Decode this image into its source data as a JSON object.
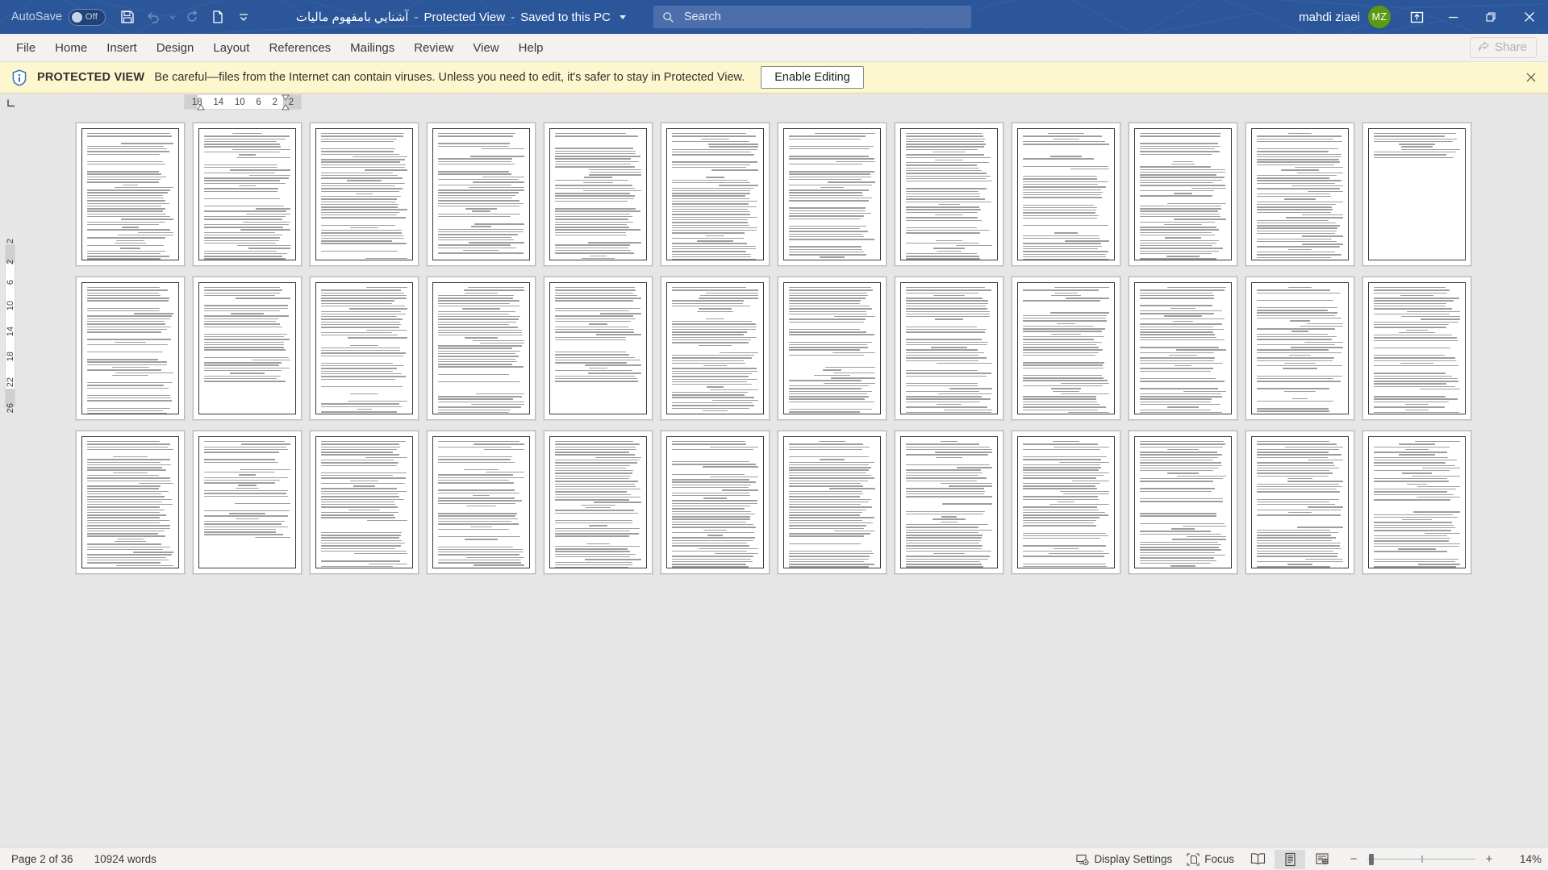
{
  "titlebar": {
    "autosave_label": "AutoSave",
    "autosave_state": "Off",
    "qat": [
      {
        "name": "save-icon",
        "label": "Save",
        "disabled": false
      },
      {
        "name": "undo-icon",
        "label": "Undo",
        "disabled": true
      },
      {
        "name": "undo-dropdown-icon",
        "label": "Undo options",
        "disabled": true
      },
      {
        "name": "redo-icon",
        "label": "Redo",
        "disabled": true
      },
      {
        "name": "print-preview-icon",
        "label": "Print Preview and Print",
        "disabled": false
      },
      {
        "name": "customize-qat-icon",
        "label": "Customize Quick Access Toolbar",
        "disabled": false
      }
    ],
    "document_name": "آشنايي بامفهوم ماليات",
    "protected_view_tag": "Protected View",
    "save_state": "Saved to this PC",
    "search_placeholder": "Search",
    "search_value": "",
    "account_name": "mahdi ziaei",
    "account_initials": "MZ",
    "ribbon_display_label": "Ribbon Display Options",
    "minimize_label": "Minimize",
    "restore_label": "Restore Down",
    "close_label": "Close",
    "bg_color": "#2b579a",
    "avatar_color": "#5a9b13"
  },
  "ribbon": {
    "tabs": [
      {
        "label": "File",
        "active": false
      },
      {
        "label": "Home",
        "active": false
      },
      {
        "label": "Insert",
        "active": false
      },
      {
        "label": "Design",
        "active": false
      },
      {
        "label": "Layout",
        "active": false
      },
      {
        "label": "References",
        "active": false
      },
      {
        "label": "Mailings",
        "active": false
      },
      {
        "label": "Review",
        "active": false
      },
      {
        "label": "View",
        "active": false
      },
      {
        "label": "Help",
        "active": false
      }
    ],
    "share_label": "Share"
  },
  "protected_view": {
    "badge": "PROTECTED VIEW",
    "message": "Be careful—files from the Internet can contain viruses. Unless you need to edit, it's safer to stay in Protected View.",
    "enable_label": "Enable Editing",
    "close_label": "Close Message Bar",
    "bg_color": "#fdf7cf"
  },
  "rulers": {
    "horizontal_ticks": [
      "18",
      "14",
      "10",
      "6",
      "2",
      "2"
    ],
    "vertical_ticks": [
      "2",
      "2",
      "6",
      "10",
      "14",
      "18",
      "22",
      "26"
    ],
    "tab_selector_label": "Left Tab"
  },
  "document": {
    "zoom_percent": 14,
    "total_pages": 36,
    "visible_page_count": 36,
    "language_direction": "rtl"
  },
  "statusbar": {
    "page_indicator": "Page 2 of 36",
    "word_count": "10924 words",
    "display_settings_label": "Display Settings",
    "focus_label": "Focus",
    "view_buttons": [
      {
        "name": "read-mode-icon",
        "label": "Read Mode",
        "active": false
      },
      {
        "name": "print-layout-icon",
        "label": "Print Layout",
        "active": true
      },
      {
        "name": "web-layout-icon",
        "label": "Web Layout",
        "active": false
      }
    ],
    "zoom_out_label": "Zoom Out",
    "zoom_in_label": "Zoom In",
    "zoom_display": "14%"
  }
}
